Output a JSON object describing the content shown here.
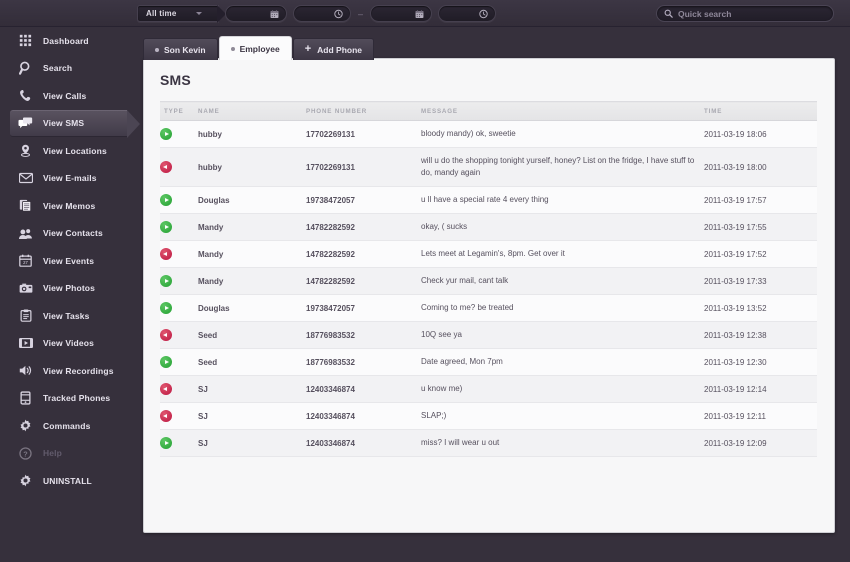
{
  "topbar": {
    "period_select": {
      "label": "All time",
      "icon": "chevron-down-icon"
    },
    "date_from": {
      "value": "",
      "icon": "calendar-icon"
    },
    "time_from": {
      "value": "",
      "icon": "clock-icon"
    },
    "range_separator": "–",
    "date_to": {
      "value": "",
      "icon": "calendar-icon"
    },
    "time_to": {
      "value": "",
      "icon": "clock-icon"
    },
    "search": {
      "placeholder": "Quick search",
      "value": "",
      "icon": "search-icon"
    }
  },
  "sidebar": {
    "items": [
      {
        "label": "Dashboard",
        "icon": "grid-icon",
        "active": false,
        "dim": false
      },
      {
        "label": "Search",
        "icon": "magnifier-icon",
        "active": false,
        "dim": false
      },
      {
        "label": "View Calls",
        "icon": "phone-icon",
        "active": false,
        "dim": false
      },
      {
        "label": "View SMS",
        "icon": "chat-bubble-icon",
        "active": true,
        "dim": false
      },
      {
        "label": "View Locations",
        "icon": "map-pin-icon",
        "active": false,
        "dim": false
      },
      {
        "label": "View E-mails",
        "icon": "envelope-icon",
        "active": false,
        "dim": false
      },
      {
        "label": "View Memos",
        "icon": "documents-icon",
        "active": false,
        "dim": false
      },
      {
        "label": "View Contacts",
        "icon": "people-icon",
        "active": false,
        "dim": false
      },
      {
        "label": "View Events",
        "icon": "calendar-icon",
        "active": false,
        "dim": false
      },
      {
        "label": "View Photos",
        "icon": "camera-icon",
        "active": false,
        "dim": false
      },
      {
        "label": "View Tasks",
        "icon": "clipboard-icon",
        "active": false,
        "dim": false
      },
      {
        "label": "View Videos",
        "icon": "film-icon",
        "active": false,
        "dim": false
      },
      {
        "label": "View Recordings",
        "icon": "speaker-icon",
        "active": false,
        "dim": false
      },
      {
        "label": "Tracked Phones",
        "icon": "mobile-icon",
        "active": false,
        "dim": false
      },
      {
        "label": "Commands",
        "icon": "gear-icon",
        "active": false,
        "dim": false
      },
      {
        "label": "Help",
        "icon": "question-icon",
        "active": false,
        "dim": true
      },
      {
        "label": "UNINSTALL",
        "icon": "gear-icon",
        "active": false,
        "dim": false
      }
    ]
  },
  "tabs": [
    {
      "label": "Son Kevin",
      "active": false,
      "kind": "device"
    },
    {
      "label": "Employee",
      "active": true,
      "kind": "device"
    },
    {
      "label": "Add Phone",
      "active": false,
      "kind": "add"
    }
  ],
  "panel": {
    "title": "SMS",
    "columns": [
      "TYPE",
      "NAME",
      "PHONE NUMBER",
      "MESSAGE",
      "TIME"
    ],
    "rows": [
      {
        "type": "incoming",
        "name": "hubby",
        "phone": "17702269131",
        "message": "bloody mandy) ok, sweetie",
        "time": "2011-03-19 18:06"
      },
      {
        "type": "outgoing",
        "name": "hubby",
        "phone": "17702269131",
        "message": "will u do the shopping tonight yurself, honey? List on the fridge, I have stuff to do, mandy again",
        "time": "2011-03-19 18:00"
      },
      {
        "type": "incoming",
        "name": "Douglas",
        "phone": "19738472057",
        "message": "u ll have a special rate 4 every thing",
        "time": "2011-03-19 17:57"
      },
      {
        "type": "incoming",
        "name": "Mandy",
        "phone": "14782282592",
        "message": "okay, ( sucks",
        "time": "2011-03-19 17:55"
      },
      {
        "type": "outgoing",
        "name": "Mandy",
        "phone": "14782282592",
        "message": "Lets meet at Legamin's, 8pm. Get over it",
        "time": "2011-03-19 17:52"
      },
      {
        "type": "incoming",
        "name": "Mandy",
        "phone": "14782282592",
        "message": "Check yur mail, cant talk",
        "time": "2011-03-19 17:33"
      },
      {
        "type": "incoming",
        "name": "Douglas",
        "phone": "19738472057",
        "message": "Coming to me? be treated",
        "time": "2011-03-19 13:52"
      },
      {
        "type": "outgoing",
        "name": "Seed",
        "phone": "18776983532",
        "message": "10Q see ya",
        "time": "2011-03-19 12:38"
      },
      {
        "type": "incoming",
        "name": "Seed",
        "phone": "18776983532",
        "message": "Date agreed, Mon 7pm",
        "time": "2011-03-19 12:30"
      },
      {
        "type": "outgoing",
        "name": "SJ",
        "phone": "12403346874",
        "message": "u know me)",
        "time": "2011-03-19 12:14"
      },
      {
        "type": "outgoing",
        "name": "SJ",
        "phone": "12403346874",
        "message": "SLAP;)",
        "time": "2011-03-19 12:11"
      },
      {
        "type": "incoming",
        "name": "SJ",
        "phone": "12403346874",
        "message": "miss? I will wear u out",
        "time": "2011-03-19 12:09"
      }
    ]
  },
  "colors": {
    "background": "#36303c",
    "panel": "#f7f7f8",
    "incoming": "#23a032",
    "outgoing": "#bb1540"
  }
}
